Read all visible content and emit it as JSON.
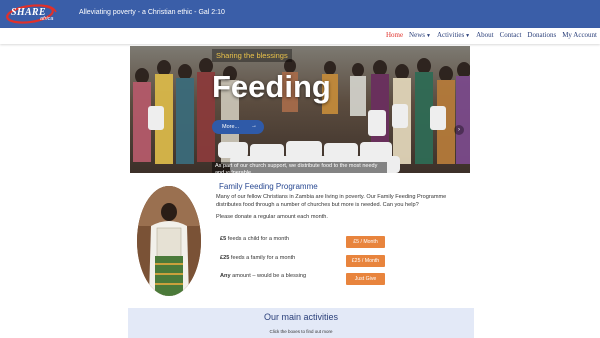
{
  "header": {
    "logo": {
      "text": "SHARE",
      "sub": "africa"
    },
    "tagline": "Alleviating poverty - a Christian ethic - Gal 2:10"
  },
  "nav": {
    "items": [
      {
        "label": "Home",
        "active": true
      },
      {
        "label": "News",
        "dropdown": true
      },
      {
        "label": "Activities",
        "dropdown": true
      },
      {
        "label": "About"
      },
      {
        "label": "Contact"
      },
      {
        "label": "Donations"
      },
      {
        "label": "My Account"
      }
    ]
  },
  "hero": {
    "kicker": "Sharing the blessings",
    "title": "Feeding",
    "button_label": "More...",
    "button_arrow": "→",
    "caption": "As part of our church support, we distribute food to the most needy and vulnerable."
  },
  "feature": {
    "title": "Family Feeding Programme",
    "paragraph": "Many of our fellow Christians in Zambia are living in poverty. Our Family Feeding Programme distributes food through a number of churches but more is needed. Can you help?",
    "prompt": "Please donate a regular amount each month.",
    "rows": [
      {
        "amount": "£5",
        "text": " feeds a child for a month",
        "button": "£5 / Month"
      },
      {
        "amount": "£25",
        "text": " feeds a family for a month",
        "button": "£25 / Month"
      },
      {
        "amount": "Any",
        "text": " amount – would be a blessing",
        "button": "Just Give"
      }
    ]
  },
  "activities": {
    "title": "Our main activities",
    "subtitle": "Click the boxes to find out more"
  },
  "colors": {
    "header_blue": "#3a5ea8",
    "nav_text": "#2a3f7a",
    "nav_active": "#e0302a",
    "kicker_gold": "#e9c24a",
    "donate_orange": "#e8843d",
    "activities_bg": "#e3e9f7"
  }
}
